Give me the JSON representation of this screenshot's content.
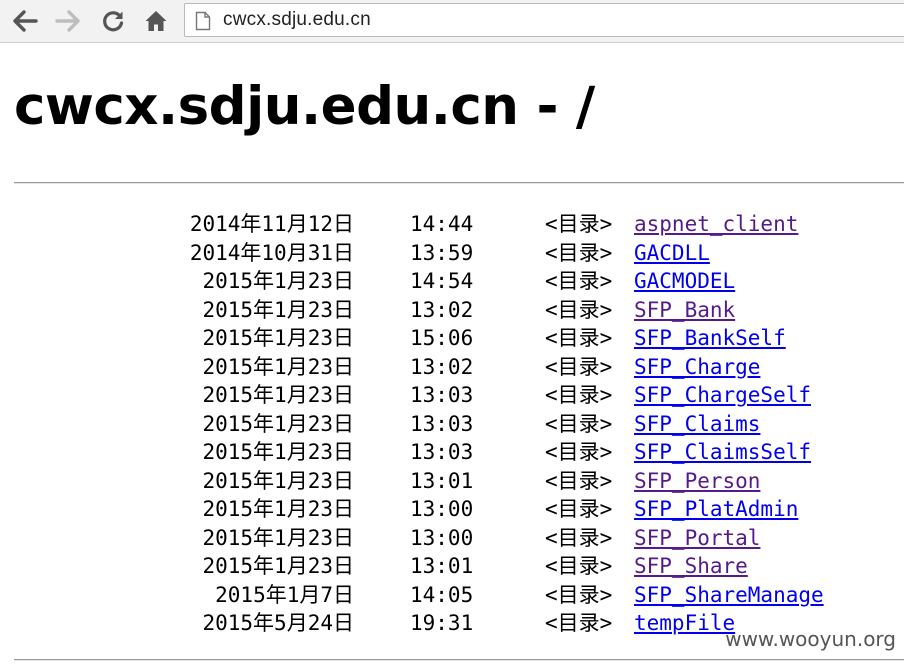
{
  "browser": {
    "url": "cwcx.sdju.edu.cn",
    "icons": [
      "back-arrow-icon",
      "forward-arrow-icon",
      "reload-icon",
      "home-icon",
      "page-icon"
    ]
  },
  "page": {
    "title": "cwcx.sdju.edu.cn - /"
  },
  "colors": {
    "visited": "#551a8b",
    "unvisited": "#0000ee"
  },
  "listing": [
    {
      "date": "2014年11月12日",
      "time": "14:44",
      "type": "<目录>",
      "name": "aspnet_client",
      "visited": true
    },
    {
      "date": "2014年10月31日",
      "time": "13:59",
      "type": "<目录>",
      "name": "GACDLL",
      "visited": false
    },
    {
      "date": "2015年1月23日",
      "time": "14:54",
      "type": "<目录>",
      "name": "GACMODEL",
      "visited": false
    },
    {
      "date": "2015年1月23日",
      "time": "13:02",
      "type": "<目录>",
      "name": "SFP_Bank",
      "visited": true
    },
    {
      "date": "2015年1月23日",
      "time": "15:06",
      "type": "<目录>",
      "name": "SFP_BankSelf",
      "visited": false
    },
    {
      "date": "2015年1月23日",
      "time": "13:02",
      "type": "<目录>",
      "name": "SFP_Charge",
      "visited": false
    },
    {
      "date": "2015年1月23日",
      "time": "13:03",
      "type": "<目录>",
      "name": "SFP_ChargeSelf",
      "visited": false
    },
    {
      "date": "2015年1月23日",
      "time": "13:03",
      "type": "<目录>",
      "name": "SFP_Claims",
      "visited": false
    },
    {
      "date": "2015年1月23日",
      "time": "13:03",
      "type": "<目录>",
      "name": "SFP_ClaimsSelf",
      "visited": false
    },
    {
      "date": "2015年1月23日",
      "time": "13:01",
      "type": "<目录>",
      "name": "SFP_Person",
      "visited": true
    },
    {
      "date": "2015年1月23日",
      "time": "13:00",
      "type": "<目录>",
      "name": "SFP_PlatAdmin",
      "visited": false
    },
    {
      "date": "2015年1月23日",
      "time": "13:00",
      "type": "<目录>",
      "name": "SFP_Portal",
      "visited": true
    },
    {
      "date": "2015年1月23日",
      "time": "13:01",
      "type": "<目录>",
      "name": "SFP_Share",
      "visited": true
    },
    {
      "date": "2015年1月7日",
      "time": "14:05",
      "type": "<目录>",
      "name": "SFP_ShareManage",
      "visited": false
    },
    {
      "date": "2015年5月24日",
      "time": "19:31",
      "type": "<目录>",
      "name": "tempFile",
      "visited": false
    }
  ],
  "watermark": "www.wooyun.org"
}
